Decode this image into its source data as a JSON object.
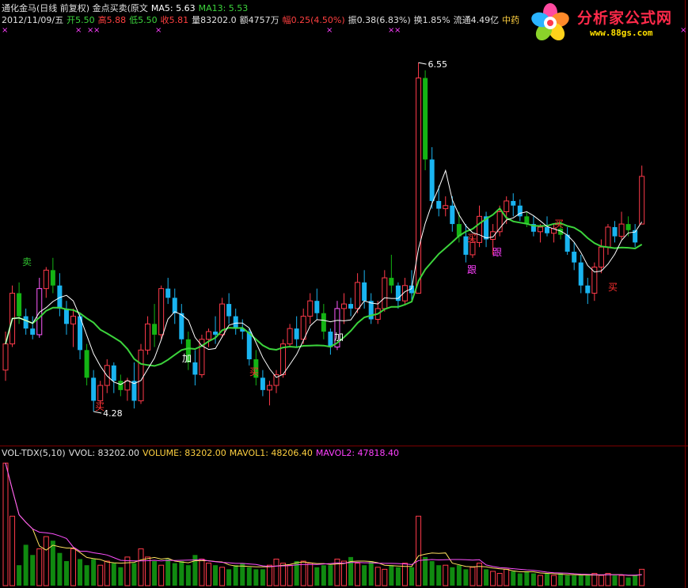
{
  "header": {
    "line1": [
      {
        "text": "通化金马(日线 前复权) 金点买卖(原文",
        "color": "#e0e0e0"
      },
      {
        "text": "MA5: 5.63",
        "color": "#ffffff"
      },
      {
        "text": "MA13: 5.53",
        "color": "#3cd43c"
      }
    ],
    "line2": [
      {
        "text": "2012/11/09/五",
        "color": "#e0e0e0"
      },
      {
        "text": "开5.50",
        "color": "#3cd43c"
      },
      {
        "text": "高5.88",
        "color": "#ff4040"
      },
      {
        "text": "低5.50",
        "color": "#3cd43c"
      },
      {
        "text": "收5.81",
        "color": "#ff4040"
      },
      {
        "text": "量83202.0",
        "color": "#e0e0e0"
      },
      {
        "text": "额4757万",
        "color": "#e0e0e0"
      },
      {
        "text": "幅0.25(4.50%)",
        "color": "#ff4040"
      },
      {
        "text": "振0.38(6.83%)",
        "color": "#e0e0e0"
      },
      {
        "text": "换1.85%",
        "color": "#e0e0e0"
      },
      {
        "text": "流通4.49亿",
        "color": "#e0e0e0"
      },
      {
        "text": "中药",
        "color": "#ffd040"
      }
    ],
    "markers": [
      "×",
      "×",
      "×",
      "×",
      "×",
      "×",
      "×",
      "×",
      "×"
    ]
  },
  "logo": {
    "title": "分析家公式网",
    "url": "www.88gs.com"
  },
  "annotations": {
    "high_price": "6.55",
    "low_price": "4.28",
    "labels": [
      {
        "text": "卖",
        "color": "#30c030"
      },
      {
        "text": "买",
        "color": "#ff3030"
      },
      {
        "text": "加",
        "color": "#ffffff"
      },
      {
        "text": "买",
        "color": "#ff3030"
      },
      {
        "text": "加",
        "color": "#ffffff"
      },
      {
        "text": "买",
        "color": "#ff3030"
      },
      {
        "text": "跟",
        "color": "#ff40ff"
      },
      {
        "text": "跟",
        "color": "#ff40ff"
      },
      {
        "text": "买",
        "color": "#ff3030"
      },
      {
        "text": "买",
        "color": "#ff3030"
      }
    ]
  },
  "volume_header": [
    {
      "text": "VOL-TDX(5,10)",
      "color": "#e0e0e0"
    },
    {
      "text": "VVOL: 83202.00",
      "color": "#e0e0e0"
    },
    {
      "text": "VOLUME: 83202.00",
      "color": "#ffd040"
    },
    {
      "text": "MAVOL1: 48206.40",
      "color": "#ffd040"
    },
    {
      "text": "MAVOL2: 47818.40",
      "color": "#ff40ff"
    }
  ],
  "colors": {
    "up": "#ff3a4a",
    "down_cyan": "#19b4f0",
    "down_green": "#14b414",
    "ma5": "#ffffff",
    "ma13": "#3cd43c",
    "magenta": "#ff5aff",
    "vol_ma1": "#ffe060",
    "vol_ma2": "#ff50ff",
    "vol_up": "#ff3a4a",
    "vol_down": "#108a10"
  },
  "chart_data": {
    "type": "candlestick",
    "ohlc": [
      [
        4.55,
        4.8,
        4.48,
        4.72
      ],
      [
        4.72,
        5.1,
        4.7,
        5.05
      ],
      [
        5.05,
        5.12,
        4.85,
        4.9
      ],
      [
        4.9,
        4.95,
        4.78,
        4.82
      ],
      [
        4.82,
        4.9,
        4.75,
        4.78
      ],
      [
        4.78,
        5.15,
        4.76,
        5.08
      ],
      [
        5.08,
        5.22,
        5.02,
        5.2
      ],
      [
        5.2,
        5.28,
        5.05,
        5.1
      ],
      [
        5.1,
        5.18,
        4.9,
        4.95
      ],
      [
        4.95,
        5.0,
        4.78,
        4.85
      ],
      [
        4.85,
        4.95,
        4.7,
        4.9
      ],
      [
        4.9,
        4.92,
        4.62,
        4.68
      ],
      [
        4.68,
        4.72,
        4.45,
        4.5
      ],
      [
        4.5,
        4.55,
        4.28,
        4.35
      ],
      [
        4.35,
        4.48,
        4.3,
        4.45
      ],
      [
        4.45,
        4.62,
        4.4,
        4.58
      ],
      [
        4.58,
        4.6,
        4.4,
        4.48
      ],
      [
        4.48,
        4.52,
        4.38,
        4.42
      ],
      [
        4.42,
        4.5,
        4.35,
        4.48
      ],
      [
        4.48,
        4.6,
        4.3,
        4.35
      ],
      [
        4.35,
        4.72,
        4.33,
        4.68
      ],
      [
        4.68,
        4.9,
        4.65,
        4.85
      ],
      [
        4.85,
        4.98,
        4.7,
        4.78
      ],
      [
        4.78,
        5.1,
        4.75,
        5.08
      ],
      [
        5.08,
        5.15,
        4.98,
        5.02
      ],
      [
        5.02,
        5.08,
        4.85,
        4.92
      ],
      [
        4.92,
        4.98,
        4.72,
        4.75
      ],
      [
        4.75,
        4.8,
        4.55,
        4.6
      ],
      [
        4.6,
        4.68,
        4.45,
        4.52
      ],
      [
        4.52,
        4.78,
        4.5,
        4.75
      ],
      [
        4.75,
        4.82,
        4.7,
        4.8
      ],
      [
        4.8,
        4.9,
        4.72,
        4.78
      ],
      [
        4.78,
        5.02,
        4.76,
        4.98
      ],
      [
        4.98,
        5.05,
        4.85,
        4.9
      ],
      [
        4.9,
        4.95,
        4.78,
        4.82
      ],
      [
        4.82,
        4.88,
        4.75,
        4.8
      ],
      [
        4.8,
        4.82,
        4.58,
        4.62
      ],
      [
        4.62,
        4.68,
        4.45,
        4.5
      ],
      [
        4.5,
        4.55,
        4.38,
        4.42
      ],
      [
        4.42,
        4.48,
        4.32,
        4.45
      ],
      [
        4.45,
        4.55,
        4.4,
        4.52
      ],
      [
        4.52,
        4.75,
        4.5,
        4.72
      ],
      [
        4.72,
        4.85,
        4.7,
        4.82
      ],
      [
        4.82,
        4.9,
        4.7,
        4.75
      ],
      [
        4.75,
        4.95,
        4.72,
        4.9
      ],
      [
        4.9,
        5.05,
        4.85,
        5.0
      ],
      [
        5.0,
        5.08,
        4.88,
        4.92
      ],
      [
        4.92,
        4.98,
        4.75,
        4.8
      ],
      [
        4.8,
        4.82,
        4.65,
        4.7
      ],
      [
        4.7,
        5.0,
        4.68,
        4.95
      ],
      [
        4.95,
        5.05,
        4.85,
        4.98
      ],
      [
        4.98,
        5.02,
        4.9,
        4.95
      ],
      [
        4.95,
        5.18,
        4.92,
        5.12
      ],
      [
        5.12,
        5.2,
        4.95,
        5.0
      ],
      [
        5.0,
        5.05,
        4.85,
        4.88
      ],
      [
        4.88,
        5.0,
        4.85,
        4.95
      ],
      [
        4.95,
        5.2,
        4.93,
        5.15
      ],
      [
        5.15,
        5.3,
        5.05,
        5.1
      ],
      [
        5.1,
        5.12,
        4.95,
        5.0
      ],
      [
        5.0,
        5.15,
        4.98,
        5.1
      ],
      [
        5.1,
        5.2,
        5.0,
        5.05
      ],
      [
        5.05,
        6.55,
        5.05,
        6.45
      ],
      [
        6.45,
        6.5,
        5.85,
        5.92
      ],
      [
        5.92,
        6.0,
        5.6,
        5.65
      ],
      [
        5.65,
        5.75,
        5.55,
        5.6
      ],
      [
        5.6,
        5.68,
        5.55,
        5.62
      ],
      [
        5.62,
        5.68,
        5.45,
        5.5
      ],
      [
        5.5,
        5.58,
        5.38,
        5.42
      ],
      [
        5.42,
        5.5,
        5.25,
        5.3
      ],
      [
        5.3,
        5.42,
        5.28,
        5.38
      ],
      [
        5.38,
        5.62,
        5.35,
        5.55
      ],
      [
        5.55,
        5.58,
        5.35,
        5.4
      ],
      [
        5.4,
        5.5,
        5.3,
        5.45
      ],
      [
        5.45,
        5.62,
        5.42,
        5.58
      ],
      [
        5.58,
        5.68,
        5.5,
        5.65
      ],
      [
        5.65,
        5.7,
        5.55,
        5.62
      ],
      [
        5.62,
        5.66,
        5.52,
        5.55
      ],
      [
        5.55,
        5.58,
        5.48,
        5.5
      ],
      [
        5.5,
        5.55,
        5.42,
        5.45
      ],
      [
        5.45,
        5.5,
        5.38,
        5.48
      ],
      [
        5.48,
        5.55,
        5.42,
        5.44
      ],
      [
        5.44,
        5.5,
        5.38,
        5.47
      ],
      [
        5.47,
        5.52,
        5.4,
        5.43
      ],
      [
        5.43,
        5.48,
        5.3,
        5.32
      ],
      [
        5.32,
        5.38,
        5.2,
        5.25
      ],
      [
        5.25,
        5.3,
        5.05,
        5.1
      ],
      [
        5.1,
        5.15,
        4.98,
        5.05
      ],
      [
        5.05,
        5.25,
        5.0,
        5.22
      ],
      [
        5.22,
        5.4,
        5.18,
        5.35
      ],
      [
        5.35,
        5.5,
        5.3,
        5.48
      ],
      [
        5.48,
        5.52,
        5.38,
        5.42
      ],
      [
        5.42,
        5.58,
        5.4,
        5.5
      ],
      [
        5.5,
        5.55,
        5.42,
        5.46
      ],
      [
        5.46,
        5.5,
        5.35,
        5.38
      ],
      [
        5.5,
        5.88,
        5.5,
        5.81
      ]
    ],
    "volume": [
      60,
      34,
      10,
      20,
      15,
      18,
      24,
      22,
      16,
      12,
      18,
      13,
      10,
      13,
      10,
      12,
      11,
      9,
      14,
      11,
      18,
      14,
      12,
      10,
      13,
      11,
      12,
      10,
      15,
      13,
      11,
      10,
      9,
      8,
      10,
      11,
      9,
      8,
      8,
      10,
      13,
      11,
      10,
      12,
      12,
      11,
      9,
      10,
      10,
      13,
      12,
      14,
      11,
      10,
      12,
      9,
      8,
      10,
      9,
      11,
      9,
      34,
      14,
      12,
      10,
      10,
      9,
      10,
      8,
      9,
      11,
      8,
      7,
      6,
      8,
      7,
      6,
      7,
      6,
      5,
      6,
      5,
      6,
      5,
      5,
      5,
      5,
      6,
      5,
      6,
      5,
      5,
      4,
      5,
      8
    ],
    "ylim": [
      4.1,
      6.7
    ]
  }
}
